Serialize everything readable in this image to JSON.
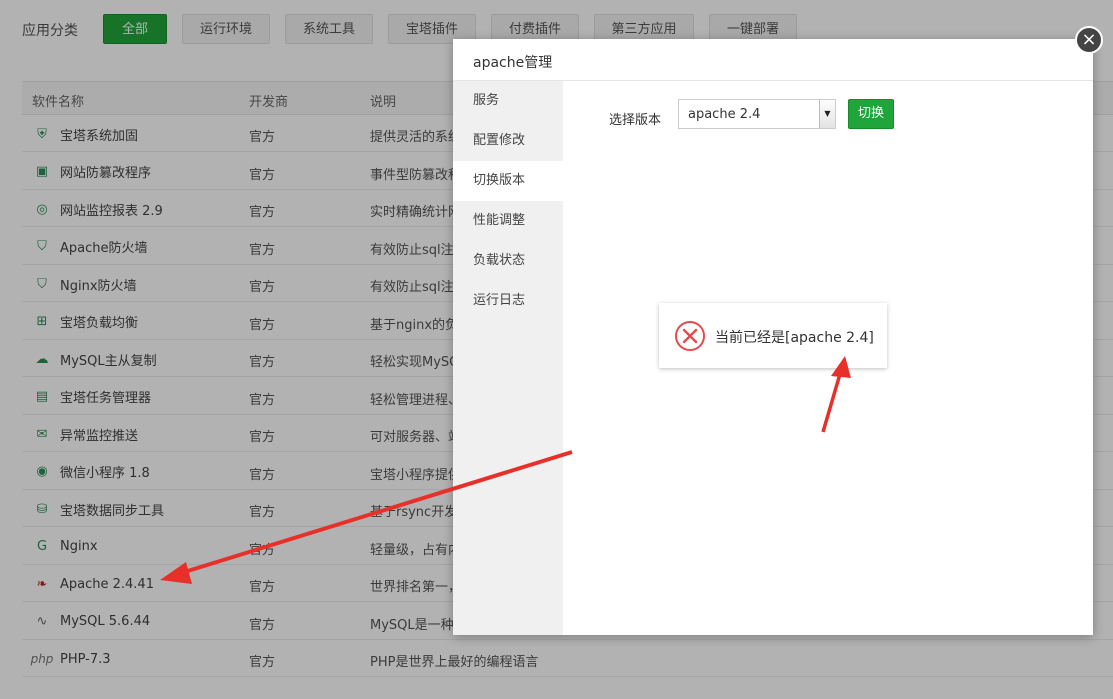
{
  "categories": {
    "label": "应用分类",
    "items": [
      "全部",
      "运行环境",
      "系统工具",
      "宝塔插件",
      "付费插件",
      "第三方应用",
      "一键部署"
    ],
    "active_index": 0
  },
  "table": {
    "headers": [
      "软件名称",
      "开发商",
      "说明"
    ],
    "rows": [
      {
        "name": "宝塔系统加固",
        "icon": "shield-icon",
        "dev": "官方",
        "desc": "提供灵活的系统"
      },
      {
        "name": "网站防篡改程序",
        "icon": "lock-page-icon",
        "dev": "官方",
        "desc": "事件型防篡改程"
      },
      {
        "name": "网站监控报表 2.9",
        "icon": "monitor-globe-icon",
        "dev": "官方",
        "desc": "实时精确统计网"
      },
      {
        "name": "Apache防火墙",
        "icon": "waf-shield-icon",
        "dev": "官方",
        "desc": "有效防止sql注入"
      },
      {
        "name": "Nginx防火墙",
        "icon": "waf-shield-icon",
        "dev": "官方",
        "desc": "有效防止sql注入"
      },
      {
        "name": "宝塔负载均衡",
        "icon": "network-tree-icon",
        "dev": "官方",
        "desc": "基于nginx的负载"
      },
      {
        "name": "MySQL主从复制",
        "icon": "cloud-sync-icon",
        "dev": "官方",
        "desc": "轻松实现MySQL"
      },
      {
        "name": "宝塔任务管理器",
        "icon": "task-manager-icon",
        "dev": "官方",
        "desc": "轻松管理进程、"
      },
      {
        "name": "异常监控推送",
        "icon": "mail-send-icon",
        "dev": "官方",
        "desc": "可对服务器、站"
      },
      {
        "name": "微信小程序 1.8",
        "icon": "wechat-miniprogram-icon",
        "dev": "官方",
        "desc": "宝塔小程序提供"
      },
      {
        "name": "宝塔数据同步工具",
        "icon": "database-sync-icon",
        "dev": "官方",
        "desc": "基于rsync开发的"
      },
      {
        "name": "Nginx",
        "icon": "nginx-icon",
        "dev": "官方",
        "desc": "轻量级，占有内"
      },
      {
        "name": "Apache 2.4.41",
        "icon": "apache-feather-icon",
        "dev": "官方",
        "desc": "世界排名第一，"
      },
      {
        "name": "MySQL 5.6.44",
        "icon": "mysql-dolphin-icon",
        "dev": "官方",
        "desc": "MySQL是一种关"
      },
      {
        "name": "PHP-7.3",
        "icon": "php-icon",
        "dev": "官方",
        "desc": "PHP是世界上最好的编程语言"
      }
    ]
  },
  "modal": {
    "title": "apache管理",
    "close_label": "×",
    "sidebar": [
      "服务",
      "配置修改",
      "切换版本",
      "性能调整",
      "负载状态",
      "运行日志"
    ],
    "active_index": 2,
    "version_label": "选择版本",
    "version_value": "apache 2.4",
    "switch_label": "切换"
  },
  "toast": {
    "message": "当前已经是[apache 2.4]",
    "icon": "error-x-icon"
  },
  "colors": {
    "accent_green": "#20a53a",
    "annotation_red": "#e8302a",
    "error_red": "#e64b4b"
  }
}
